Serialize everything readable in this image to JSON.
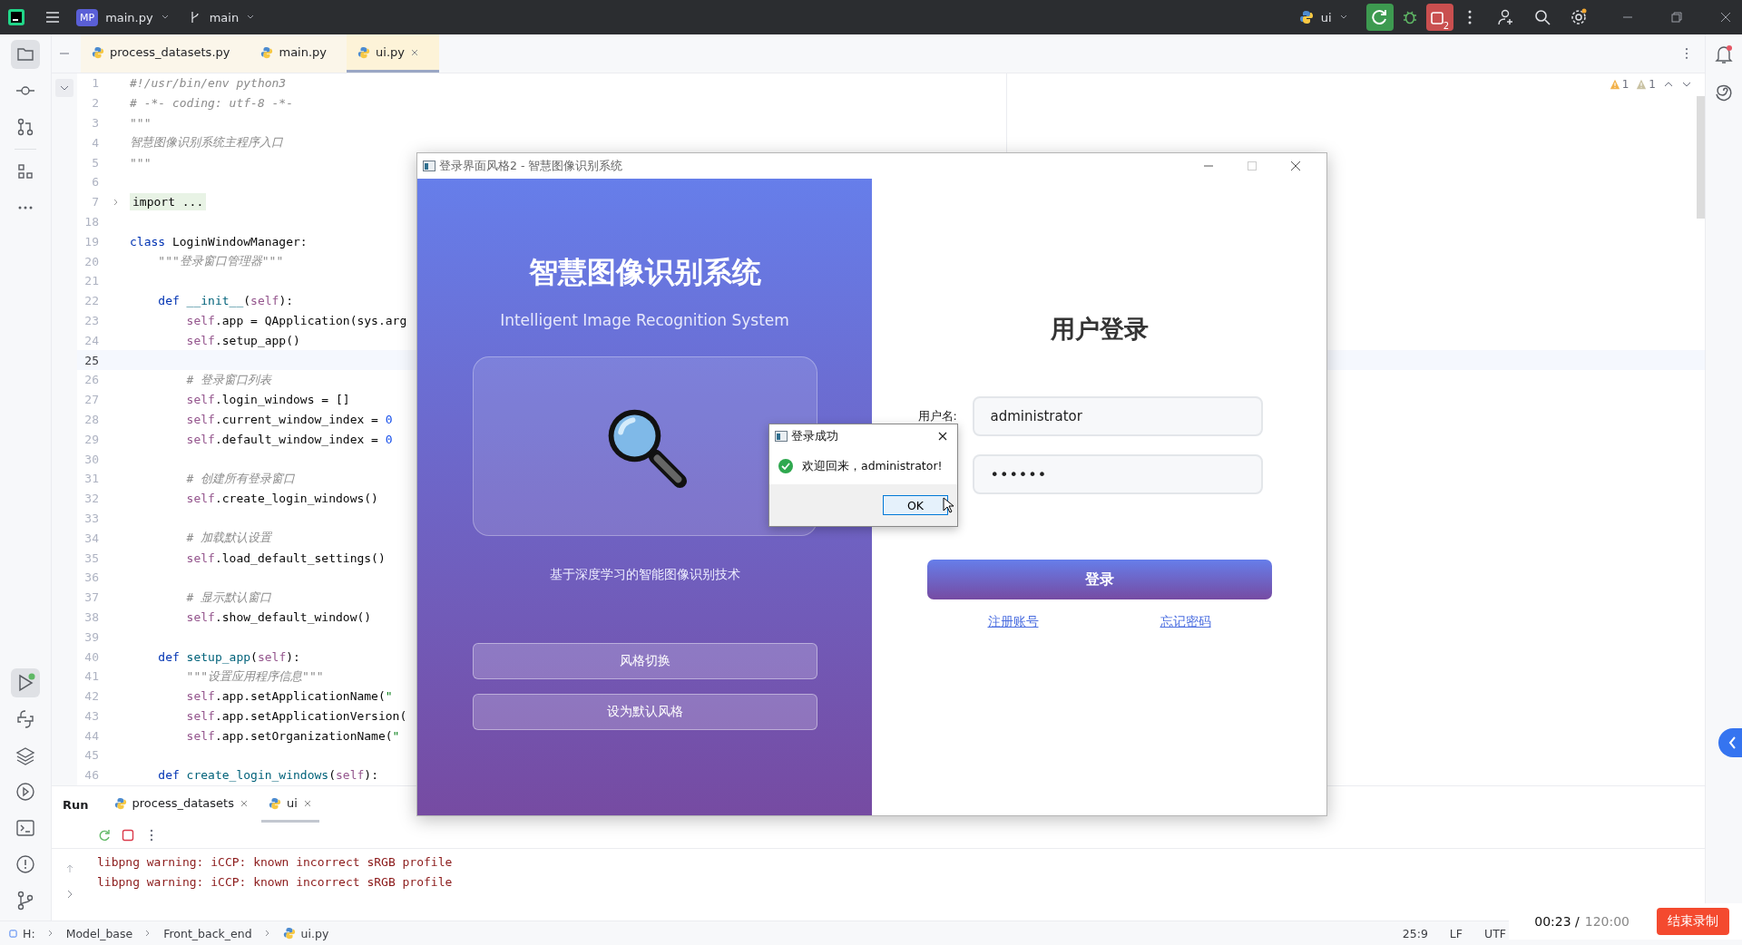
{
  "top_bar": {
    "project_badge": "MP",
    "project": "main.py",
    "branch": "main",
    "run_config": "ui",
    "stop_count": "2"
  },
  "sidebar": {
    "project_selected": true,
    "run_selected": true
  },
  "editor_tabs": [
    {
      "label": "process_datasets.py",
      "selected": false
    },
    {
      "label": "main.py",
      "selected": false
    },
    {
      "label": "ui.py",
      "selected": true
    }
  ],
  "inspections": [
    {
      "kind": "warning",
      "count": "1"
    },
    {
      "kind": "weak",
      "count": "1"
    }
  ],
  "code_lines": [
    {
      "number": "1",
      "tokens": [
        {
          "kind": "comment",
          "text": "#!/usr/bin/env python3"
        }
      ]
    },
    {
      "number": "2",
      "tokens": [
        {
          "kind": "comment",
          "text": "# -*- coding: utf-8 -*-"
        }
      ]
    },
    {
      "number": "3",
      "tokens": [
        {
          "kind": "doc",
          "text": "\"\"\""
        }
      ]
    },
    {
      "number": "4",
      "tokens": [
        {
          "kind": "doc",
          "text": "智慧图像识别系统主程序入口"
        }
      ]
    },
    {
      "number": "5",
      "tokens": [
        {
          "kind": "doc",
          "text": "\"\"\""
        }
      ]
    },
    {
      "number": "6"
    },
    {
      "number": "7",
      "tokens": [
        {
          "kind": "folded",
          "text": "import ..."
        }
      ]
    },
    {
      "number": "18"
    },
    {
      "number": "19",
      "tokens": [
        {
          "kind": "keyword",
          "text": "class"
        },
        {
          "kind": "plain",
          "text": " LoginWindowManager:"
        }
      ]
    },
    {
      "number": "20",
      "tokens": [
        {
          "kind": "doc",
          "text": "    \"\"\"登录窗口管理器\"\"\""
        }
      ]
    },
    {
      "number": "21"
    },
    {
      "number": "22",
      "tokens": [
        {
          "kind": "keyword",
          "text": "    def"
        },
        {
          "kind": "func",
          "text": " __init__"
        },
        {
          "kind": "plain",
          "text": "("
        },
        {
          "kind": "self",
          "text": "self"
        },
        {
          "kind": "plain",
          "text": "):"
        }
      ]
    },
    {
      "number": "23",
      "tokens": [
        {
          "kind": "self",
          "text": "        self"
        },
        {
          "kind": "plain",
          "text": ".app = QApplication(sys.arg"
        }
      ]
    },
    {
      "number": "24",
      "tokens": [
        {
          "kind": "self",
          "text": "        self"
        },
        {
          "kind": "plain",
          "text": ".setup_app()"
        }
      ]
    },
    {
      "number": "25",
      "current": true
    },
    {
      "number": "26",
      "tokens": [
        {
          "kind": "comment",
          "text": "        # 登录窗口列表"
        }
      ]
    },
    {
      "number": "27",
      "tokens": [
        {
          "kind": "self",
          "text": "        self"
        },
        {
          "kind": "plain",
          "text": ".login_windows = []"
        }
      ]
    },
    {
      "number": "28",
      "tokens": [
        {
          "kind": "self",
          "text": "        self"
        },
        {
          "kind": "plain",
          "text": ".current_window_index = "
        },
        {
          "kind": "number",
          "text": "0"
        }
      ]
    },
    {
      "number": "29",
      "tokens": [
        {
          "kind": "self",
          "text": "        self"
        },
        {
          "kind": "plain",
          "text": ".default_window_index = "
        },
        {
          "kind": "number",
          "text": "0"
        }
      ]
    },
    {
      "number": "30"
    },
    {
      "number": "31",
      "tokens": [
        {
          "kind": "comment",
          "text": "        # 创建所有登录窗口"
        }
      ]
    },
    {
      "number": "32",
      "tokens": [
        {
          "kind": "self",
          "text": "        self"
        },
        {
          "kind": "plain",
          "text": ".create_login_windows()"
        }
      ]
    },
    {
      "number": "33"
    },
    {
      "number": "34",
      "tokens": [
        {
          "kind": "comment",
          "text": "        # 加载默认设置"
        }
      ]
    },
    {
      "number": "35",
      "tokens": [
        {
          "kind": "self",
          "text": "        self"
        },
        {
          "kind": "plain",
          "text": ".load_default_settings()"
        }
      ]
    },
    {
      "number": "36"
    },
    {
      "number": "37",
      "tokens": [
        {
          "kind": "comment",
          "text": "        # 显示默认窗口"
        }
      ]
    },
    {
      "number": "38",
      "tokens": [
        {
          "kind": "self",
          "text": "        self"
        },
        {
          "kind": "plain",
          "text": ".show_default_window()"
        }
      ]
    },
    {
      "number": "39"
    },
    {
      "number": "40",
      "tokens": [
        {
          "kind": "keyword",
          "text": "    def"
        },
        {
          "kind": "func",
          "text": " setup_app"
        },
        {
          "kind": "plain",
          "text": "("
        },
        {
          "kind": "self",
          "text": "self"
        },
        {
          "kind": "plain",
          "text": "):"
        }
      ]
    },
    {
      "number": "41",
      "tokens": [
        {
          "kind": "doc",
          "text": "        \"\"\"设置应用程序信息\"\"\""
        }
      ]
    },
    {
      "number": "42",
      "tokens": [
        {
          "kind": "self",
          "text": "        self"
        },
        {
          "kind": "plain",
          "text": ".app.setApplicationName("
        },
        {
          "kind": "string",
          "text": "\""
        }
      ]
    },
    {
      "number": "43",
      "tokens": [
        {
          "kind": "self",
          "text": "        self"
        },
        {
          "kind": "plain",
          "text": ".app.setApplicationVersion("
        }
      ]
    },
    {
      "number": "44",
      "tokens": [
        {
          "kind": "self",
          "text": "        self"
        },
        {
          "kind": "plain",
          "text": ".app.setOrganizationName("
        },
        {
          "kind": "string",
          "text": "\""
        }
      ]
    },
    {
      "number": "45"
    },
    {
      "number": "46",
      "tokens": [
        {
          "kind": "keyword",
          "text": "    def"
        },
        {
          "kind": "func",
          "text": " create_login_windows"
        },
        {
          "kind": "plain",
          "text": "("
        },
        {
          "kind": "self",
          "text": "self"
        },
        {
          "kind": "plain",
          "text": "):"
        }
      ]
    }
  ],
  "login_window": {
    "title": "登录界面风格2 - 智慧图像识别系统",
    "brand_title": "智慧图像识别系统",
    "brand_subtitle": "Intelligent Image Recognition System",
    "tagline": "基于深度学习的智能图像识别技术",
    "side_buttons": [
      "风格切换",
      "设为默认风格"
    ],
    "heading": "用户登录",
    "username_label": "用户名:",
    "username": "administrator",
    "password": "••••••",
    "login_button": "登录",
    "links": [
      "注册账号",
      "忘记密码"
    ]
  },
  "message_box": {
    "title": "登录成功",
    "message": "欢迎回来，administrator!",
    "button": "OK"
  },
  "run_panel": {
    "title": "Run",
    "tabs": [
      {
        "label": "process_datasets",
        "selected": false
      },
      {
        "label": "ui",
        "selected": true
      }
    ],
    "output": [
      "libpng warning: iCCP: known incorrect sRGB profile",
      "libpng warning: iCCP: known incorrect sRGB profile"
    ]
  },
  "breadcrumbs": [
    "H:",
    "Model_base",
    "Front_back_end",
    "ui.py"
  ],
  "status": {
    "position": "25:9",
    "line_ending": "LF",
    "encoding": "UTF"
  },
  "recording": {
    "elapsed": "00:23 /",
    "total": "120:00",
    "stop_button": "结束录制"
  }
}
